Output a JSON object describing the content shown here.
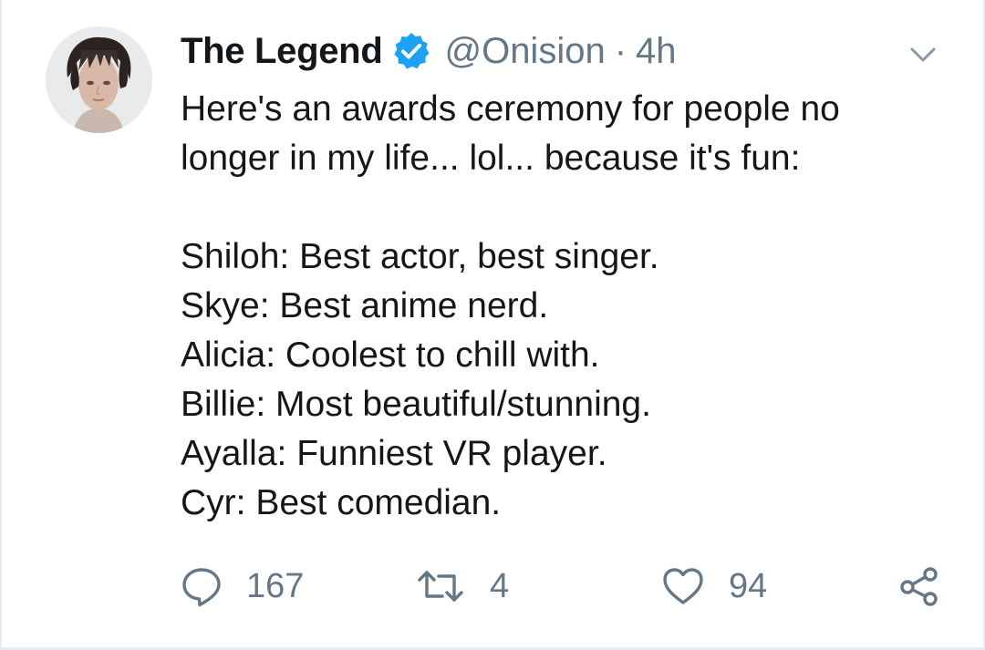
{
  "tweet": {
    "author": {
      "display_name": "The Legend",
      "handle": "@Onision",
      "verified_icon": "verified-badge-icon"
    },
    "separator": "·",
    "time": "4h",
    "text_lines": [
      "Here's an awards ceremony for people no",
      "longer in my life... lol... because it's fun:",
      "",
      "Shiloh: Best actor, best singer.",
      "Skye: Best anime nerd.",
      "Alicia: Coolest to chill with.",
      "Billie: Most beautiful/stunning.",
      "Ayalla: Funniest VR player.",
      "Cyr: Best comedian."
    ],
    "actions": {
      "reply_count": "167",
      "retweet_count": "4",
      "like_count": "94"
    }
  },
  "colors": {
    "text": "#14171a",
    "secondary_text": "#657786",
    "verified_blue": "#1da1f2",
    "border": "#e6ecf0"
  },
  "icons": [
    "verified-badge-icon",
    "chevron-down-icon",
    "reply-icon",
    "retweet-icon",
    "like-icon",
    "share-icon"
  ]
}
